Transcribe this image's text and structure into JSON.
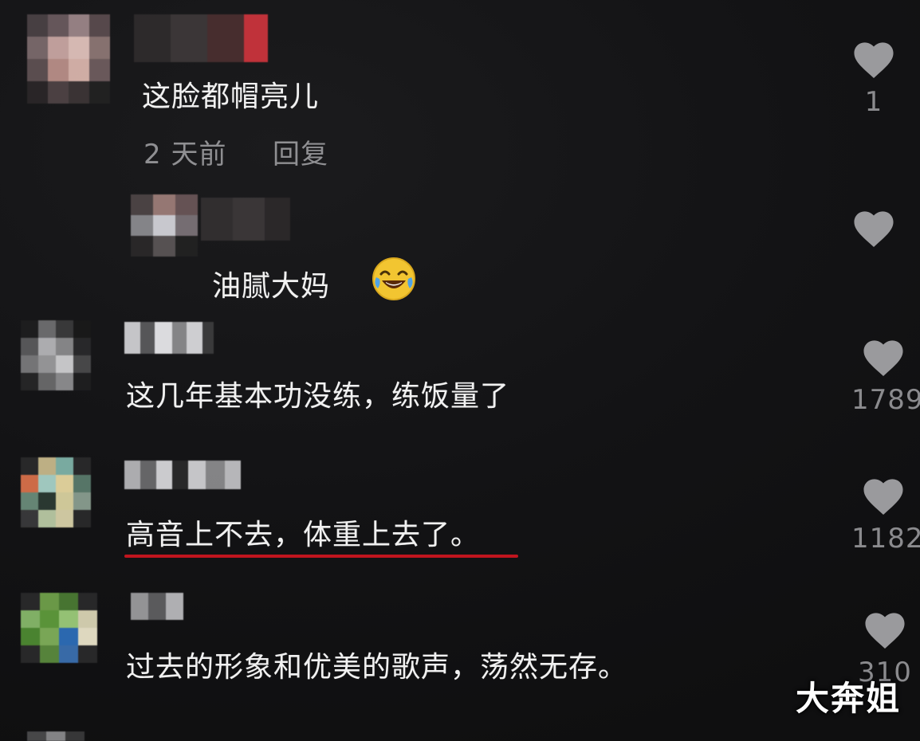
{
  "comments": [
    {
      "text": "这脸都帽亮儿",
      "time": "2 天前",
      "reply_label": "回复",
      "likes": "1"
    },
    {
      "text": "油腻大妈",
      "emoji": "laughing-tears-emoji",
      "likes": ""
    },
    {
      "text": "这几年基本功没练，练饭量了",
      "likes": "1789"
    },
    {
      "text": "高音上不去，体重上去了。",
      "likes": "1182",
      "underline_color": "#c0151e"
    },
    {
      "text": "过去的形象和优美的歌声，荡然无存。",
      "likes": "310"
    }
  ],
  "watermark": "大奔姐",
  "colors": {
    "background": "#141416",
    "text": "#f1f1f1",
    "meta": "#8f8f92",
    "heart": "#9a9a9d",
    "underline": "#c0151e"
  }
}
